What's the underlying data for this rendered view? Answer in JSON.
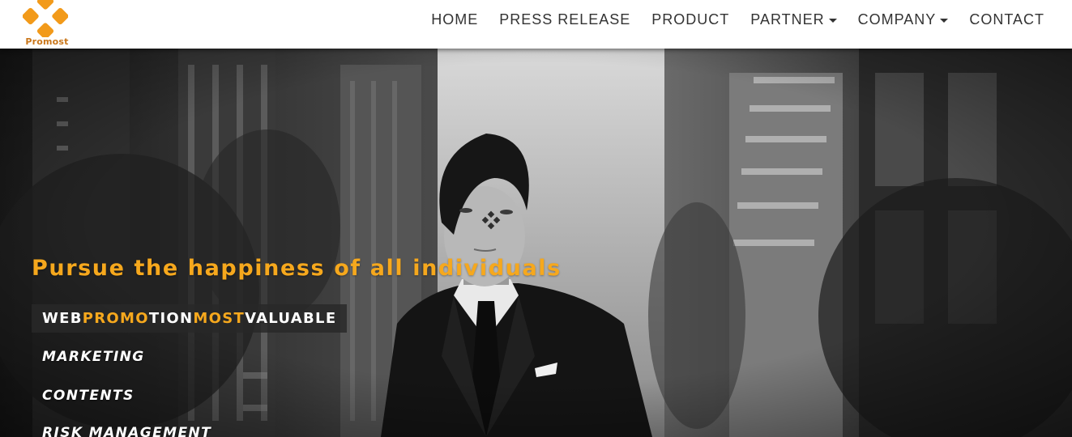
{
  "header": {
    "logo_text": "Promost",
    "nav": [
      {
        "label": "HOME",
        "dropdown": false
      },
      {
        "label": "PRESS RELEASE",
        "dropdown": false
      },
      {
        "label": "PRODUCT",
        "dropdown": false
      },
      {
        "label": "PARTNER",
        "dropdown": true
      },
      {
        "label": "COMPANY",
        "dropdown": true
      },
      {
        "label": "CONTACT",
        "dropdown": false
      }
    ]
  },
  "hero": {
    "tagline": "Pursue the happiness of all individuals",
    "brand_line": {
      "part1": "WEB ",
      "part2": "PROMO",
      "part3": "TION ",
      "part4": "MOST",
      "part5": " VALUABLE"
    },
    "services": [
      "MARKETING",
      "CONTENTS",
      "RISK MANAGEMENT"
    ]
  },
  "colors": {
    "accent": "#f6a81d",
    "logo": "#f29a1a",
    "nav_text": "#333333",
    "header_bg": "#ffffff"
  },
  "icons": {
    "logo": "promost-diamond-logo",
    "dropdown": "caret-down-icon"
  }
}
